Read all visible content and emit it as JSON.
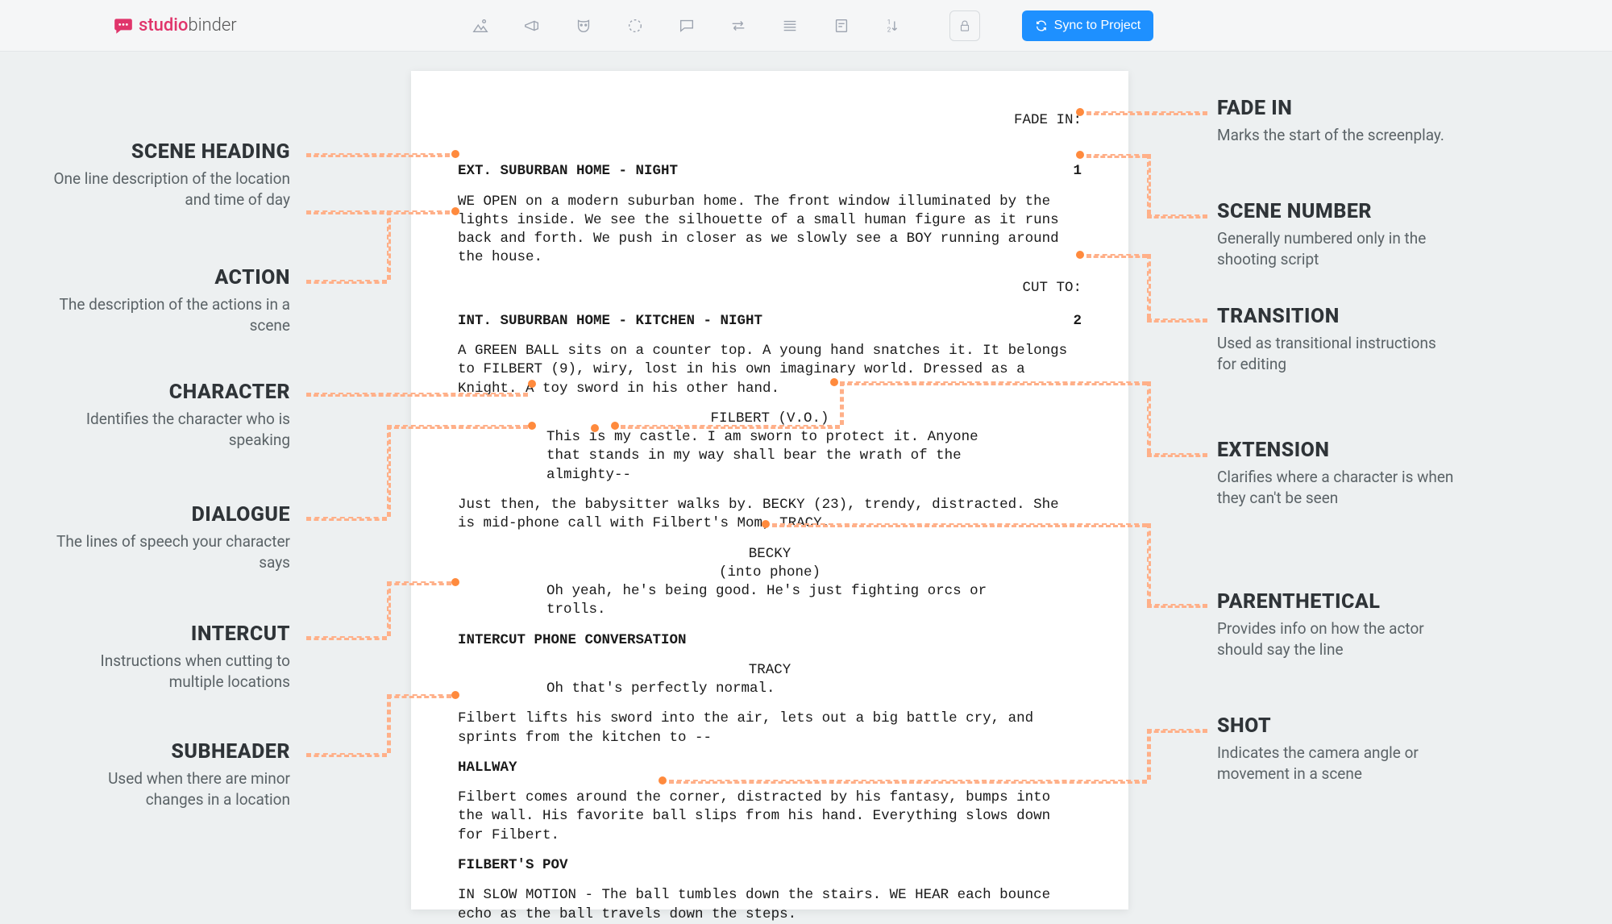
{
  "brand": {
    "name": "studio",
    "name2": "binder"
  },
  "toolbar": {
    "sync_label": "Sync to Project"
  },
  "annotations": {
    "left": [
      {
        "t": "SCENE HEADING",
        "d": "One line description of the location and time of day"
      },
      {
        "t": "ACTION",
        "d": "The description of the actions in a scene"
      },
      {
        "t": "CHARACTER",
        "d": "Identifies the character who is speaking"
      },
      {
        "t": "DIALOGUE",
        "d": "The lines of speech your character says"
      },
      {
        "t": "INTERCUT",
        "d": "Instructions when cutting to multiple locations"
      },
      {
        "t": "SUBHEADER",
        "d": "Used when there are minor changes in a location"
      }
    ],
    "right": [
      {
        "t": "FADE IN",
        "d": "Marks the start of the screenplay."
      },
      {
        "t": "SCENE NUMBER",
        "d": "Generally numbered only in the shooting script"
      },
      {
        "t": "TRANSITION",
        "d": "Used as transitional instructions for editing"
      },
      {
        "t": "EXTENSION",
        "d": "Clarifies where a character is when they can't be seen"
      },
      {
        "t": "PARENTHETICAL",
        "d": "Provides info on how the actor should say the line"
      },
      {
        "t": "SHOT",
        "d": "Indicates the camera angle or movement in a scene"
      }
    ]
  },
  "script": {
    "fadein": "FADE IN:",
    "s1": {
      "num": "1",
      "head": "EXT. SUBURBAN HOME - NIGHT",
      "action": "WE OPEN on a modern suburban home. The front window illuminated by the lights inside. We see the silhouette of a small human figure as it runs back and forth. We push in closer as we slowly see a BOY running around the house."
    },
    "cut": "CUT TO:",
    "s2": {
      "num": "2",
      "head": "INT. SUBURBAN HOME - KITCHEN - NIGHT",
      "action": "A GREEN BALL sits on a counter top. A young hand snatches it. It belongs to FILBERT (9), wiry, lost in his own imaginary world. Dressed as a Knight. A toy sword in his other hand."
    },
    "filbert_vo": "FILBERT (V.O.)",
    "filbert_line": "This is my castle. I am sworn to protect it. Anyone that stands in my way shall bear the wrath of the almighty--",
    "action2": "Just then, the babysitter walks by. BECKY (23), trendy, distracted. She is mid-phone call with Filbert's Mom, TRACY.",
    "becky": "BECKY",
    "becky_paren": "(into phone)",
    "becky_line": "Oh yeah, he's being good. He's just fighting orcs or trolls.",
    "intercut": "INTERCUT PHONE CONVERSATION",
    "tracy": "TRACY",
    "tracy_line": "Oh that's perfectly normal.",
    "action3": "Filbert lifts his sword into the air, lets out a big battle cry, and sprints from the kitchen to --",
    "hallway": "HALLWAY",
    "action4": "Filbert comes around the corner, distracted by his fantasy, bumps into the wall. His favorite ball slips from his hand. Everything slows down for Filbert.",
    "pov": "FILBERT'S POV",
    "action5": "IN SLOW MOTION - The ball tumbles down the stairs. WE HEAR each bounce echo as the ball travels down the steps."
  }
}
